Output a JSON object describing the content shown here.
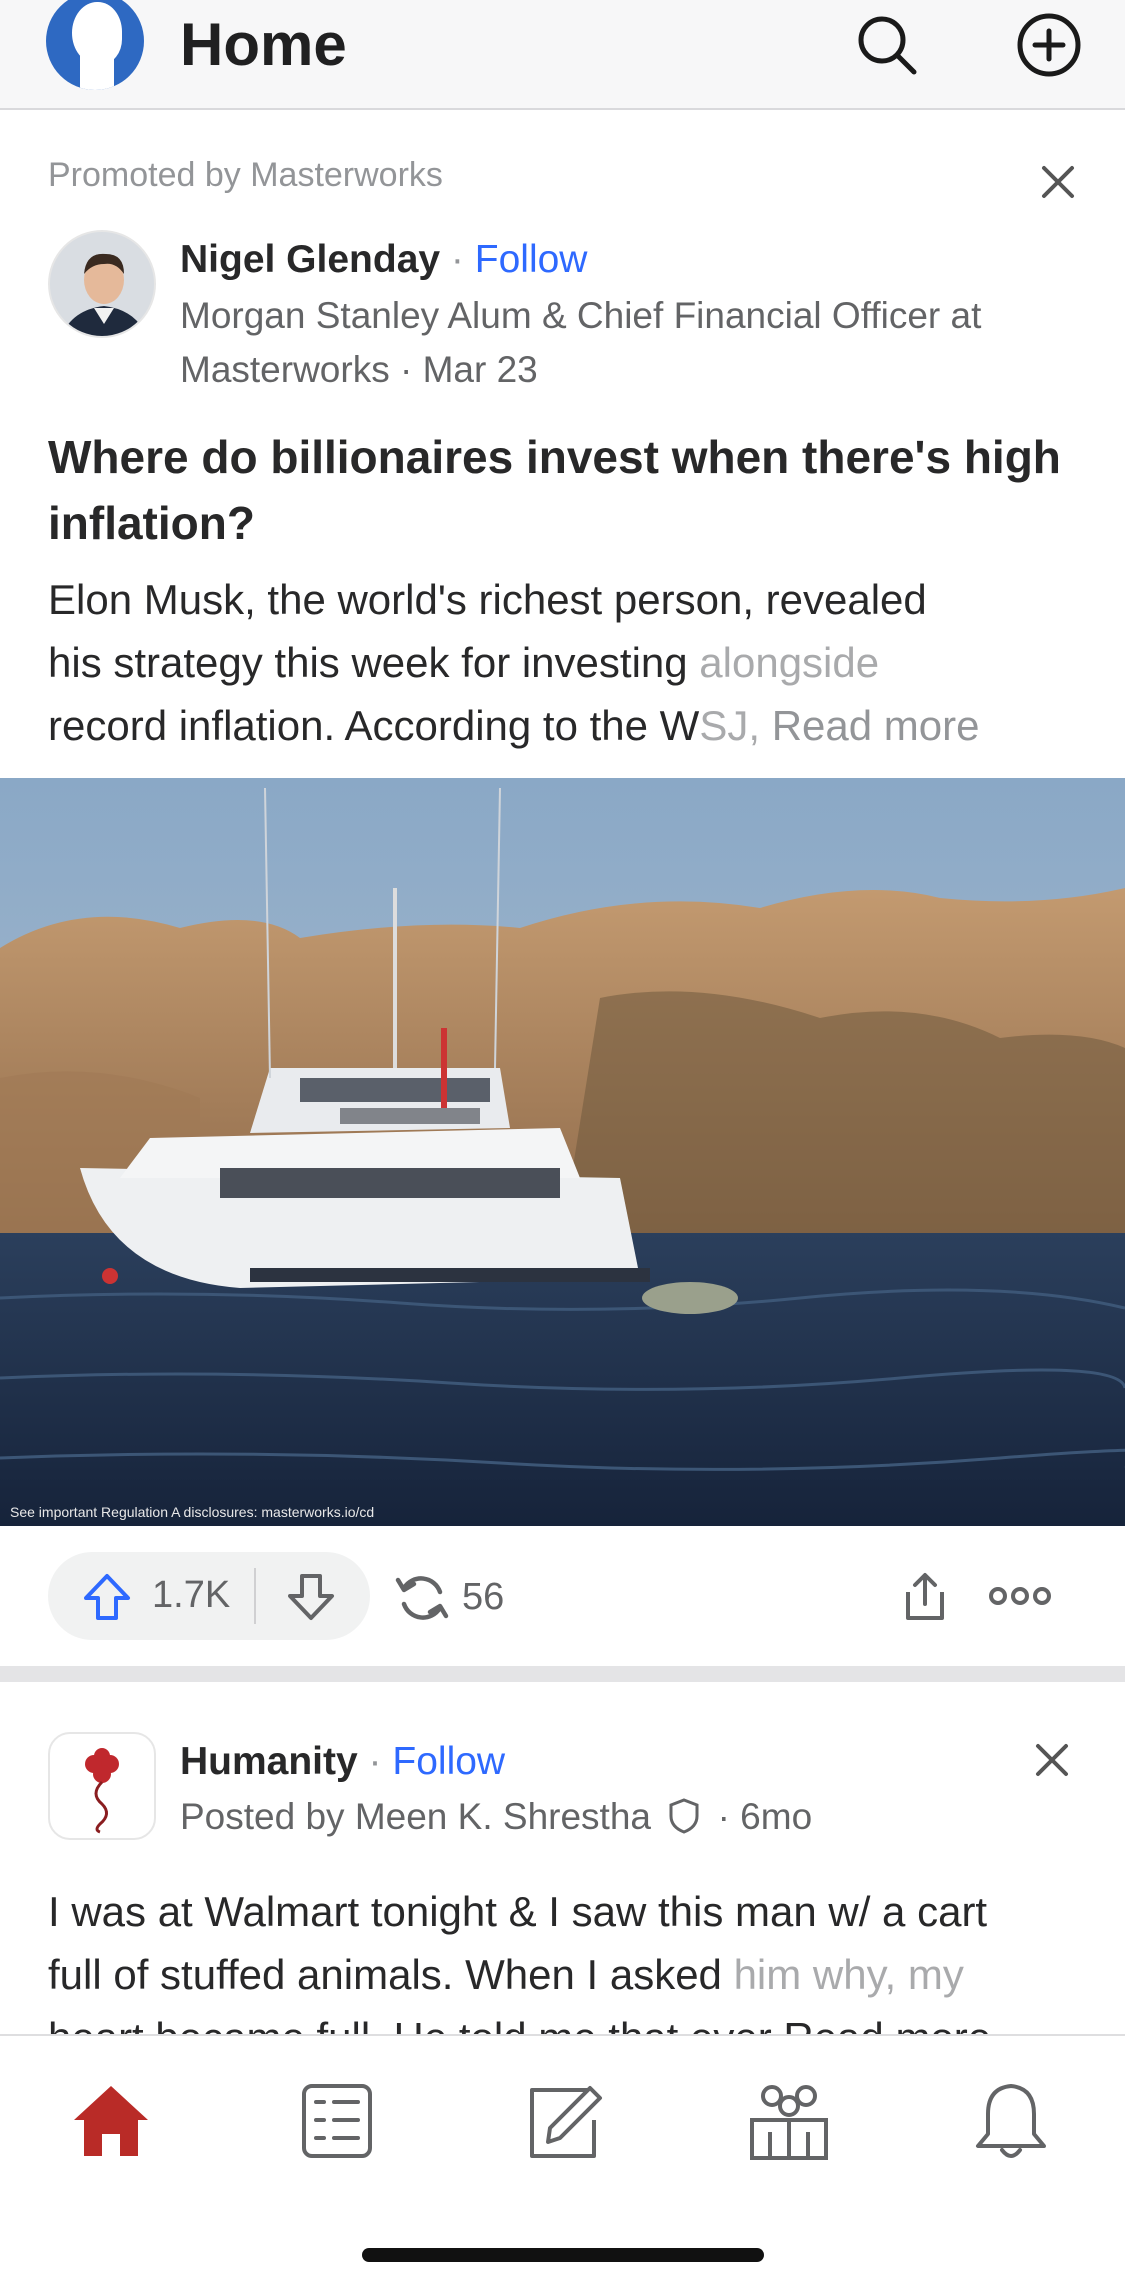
{
  "header": {
    "title": "Home",
    "icons": [
      "quora-logo-icon",
      "search-icon",
      "add-circle-icon"
    ]
  },
  "post1": {
    "promoted_label": "Promoted by Masterworks",
    "author": "Nigel Glenday",
    "separator": "·",
    "follow_label": "Follow",
    "credential_line1": "Morgan Stanley Alum & Chief Financial Officer at",
    "credential_line2": "Masterworks · Mar 23",
    "title": "Where do billionaires invest when there's high inflation?",
    "body_line1": "Elon Musk, the world's richest person, revealed",
    "body_line2_main": "his strategy this week for investing ",
    "body_line2_fade": "alongside",
    "body_line3_main": "record inflation. According to the W",
    "body_line3_fade": "SJ, ",
    "read_more": "Read more",
    "image_caption": "See important Regulation A disclosures: masterworks.io/cd",
    "upvotes": "1.7K",
    "shares": "56"
  },
  "post2": {
    "space_name": "Humanity",
    "separator": "·",
    "follow_label": "Follow",
    "posted_by": "Posted by Meen K. Shrestha",
    "age": "· 6mo",
    "body_line1": "I was at Walmart tonight & I saw this man w/ a cart",
    "body_line2_main": "full of stuffed animals. When I asked ",
    "body_line2_fade": "him why, my",
    "body_line3": "heart became full. He told me that ever Read more"
  },
  "bottom_nav": [
    "home-icon",
    "following-icon",
    "answer-icon",
    "spaces-icon",
    "notifications-icon"
  ],
  "colors": {
    "accent": "#b92b27",
    "link": "#2e69ff",
    "logo": "#2e69c2"
  }
}
